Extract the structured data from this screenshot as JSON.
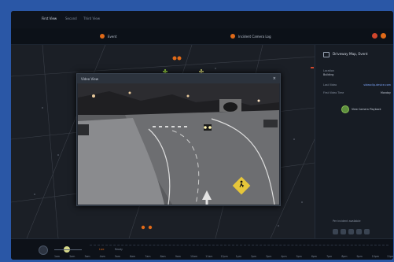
{
  "tabs": [
    "First View",
    "Second",
    "Third View"
  ],
  "alerts": [
    {
      "label": "Event",
      "color": "#e06a18"
    },
    {
      "label": "Incident Camera Log",
      "color": "#e06a18"
    }
  ],
  "right_panel": {
    "title": "Driveway Map, Event",
    "rows": [
      {
        "label": "Location",
        "value": "Building"
      },
      {
        "label": "Last Video",
        "value": "videoclip.device.com"
      },
      {
        "label": "First Video Time",
        "value": "Monday"
      }
    ],
    "action_label": "View Camera Playback",
    "footer_label": "Per incident available"
  },
  "modal": {
    "title": "Video View",
    "close_glyph": "×"
  },
  "timeline": {
    "left_label": "Live",
    "center_label": "Ready",
    "hours": [
      "1am",
      "2am",
      "3am",
      "4am",
      "5am",
      "6am",
      "7am",
      "8am",
      "9am",
      "10am",
      "11am",
      "12pm",
      "1pm",
      "2pm",
      "3pm",
      "4pm",
      "5pm",
      "6pm",
      "7pm",
      "8pm",
      "9pm",
      "10pm",
      "11pm"
    ],
    "scrubber_color": "#d6d98a"
  },
  "icons": [
    "chevron-icon",
    "map-marker-icon",
    "gear-icon",
    "close-icon",
    "camera-icon",
    "pedestrian-sign-icon",
    "play-icon"
  ]
}
